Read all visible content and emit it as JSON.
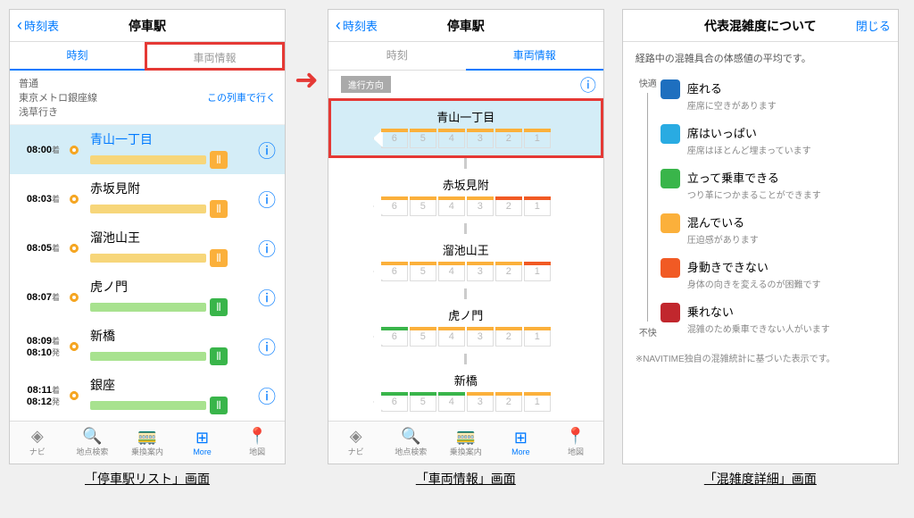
{
  "header": {
    "back": "時刻表",
    "title": "停車駅",
    "close": "閉じる"
  },
  "tabs": {
    "time": "時刻",
    "car": "車両情報"
  },
  "info": {
    "type": "普通",
    "line": "東京メトロ銀座線",
    "dest": "浅草行き",
    "go": "この列車で行く",
    "dir": "進行方向"
  },
  "stops": [
    {
      "t1": "08:00",
      "s1": "着",
      "name": "青山一丁目",
      "barColor": "bar-yellow",
      "iconColor": "c-yellow",
      "hl": true,
      "blue": true
    },
    {
      "t1": "08:03",
      "s1": "着",
      "name": "赤坂見附",
      "barColor": "bar-yellow",
      "iconColor": "c-yellow"
    },
    {
      "t1": "08:05",
      "s1": "着",
      "name": "溜池山王",
      "barColor": "bar-yellow",
      "iconColor": "c-yellow"
    },
    {
      "t1": "08:07",
      "s1": "着",
      "name": "虎ノ門",
      "barColor": "bar-green",
      "iconColor": "c-green"
    },
    {
      "t1": "08:09",
      "s1": "着",
      "t2": "08:10",
      "s2": "発",
      "name": "新橋",
      "barColor": "bar-green",
      "iconColor": "c-green"
    },
    {
      "t1": "08:11",
      "s1": "着",
      "t2": "08:12",
      "s2": "発",
      "name": "銀座",
      "barColor": "bar-green",
      "iconColor": "c-green"
    }
  ],
  "carStops": [
    {
      "name": "青山一丁目",
      "hl": true,
      "cars": [
        "c-yellow",
        "c-yellow",
        "c-yellow",
        "c-yellow",
        "c-yellow",
        "c-yellow"
      ]
    },
    {
      "name": "赤坂見附",
      "cars": [
        "c-yellow",
        "c-yellow",
        "c-yellow",
        "c-yellow",
        "c-orange",
        "c-orange"
      ]
    },
    {
      "name": "溜池山王",
      "cars": [
        "c-yellow",
        "c-yellow",
        "c-yellow",
        "c-yellow",
        "c-yellow",
        "c-orange"
      ]
    },
    {
      "name": "虎ノ門",
      "cars": [
        "c-green",
        "c-yellow",
        "c-yellow",
        "c-yellow",
        "c-yellow",
        "c-yellow"
      ]
    },
    {
      "name": "新橋",
      "cars": [
        "c-green",
        "c-green",
        "c-green",
        "c-yellow",
        "c-yellow",
        "c-yellow"
      ]
    }
  ],
  "carNums": [
    "6",
    "5",
    "4",
    "3",
    "2",
    "1"
  ],
  "legend": {
    "title": "代表混雑度について",
    "desc": "経路中の混雑具合の体感値の平均です。",
    "top": "快適",
    "bottom": "不快",
    "items": [
      {
        "c": "c-blue1",
        "t1": "座れる",
        "t2": "座席に空きがあります"
      },
      {
        "c": "c-blue2",
        "t1": "席はいっぱい",
        "t2": "座席はほとんど埋まっています"
      },
      {
        "c": "c-green",
        "t1": "立って乗車できる",
        "t2": "つり革につかまることができます"
      },
      {
        "c": "c-yellow",
        "t1": "混んでいる",
        "t2": "圧迫感があります"
      },
      {
        "c": "c-orange",
        "t1": "身動きできない",
        "t2": "身体の向きを変えるのが困難です"
      },
      {
        "c": "c-red",
        "t1": "乗れない",
        "t2": "混雑のため乗車できない人がいます"
      }
    ],
    "foot": "※NAVITIME独自の混雑統計に基づいた表示です。"
  },
  "tabbar": [
    {
      "label": "ナビ",
      "icon": "◈"
    },
    {
      "label": "地点検索",
      "icon": "🔍"
    },
    {
      "label": "乗換案内",
      "icon": "🚃"
    },
    {
      "label": "More",
      "icon": "⊞",
      "active": true
    },
    {
      "label": "地図",
      "icon": "📍"
    }
  ],
  "captions": {
    "a": "「停車駅リスト」画面",
    "b": "「車両情報」画面",
    "c": "「混雑度詳細」画面"
  }
}
